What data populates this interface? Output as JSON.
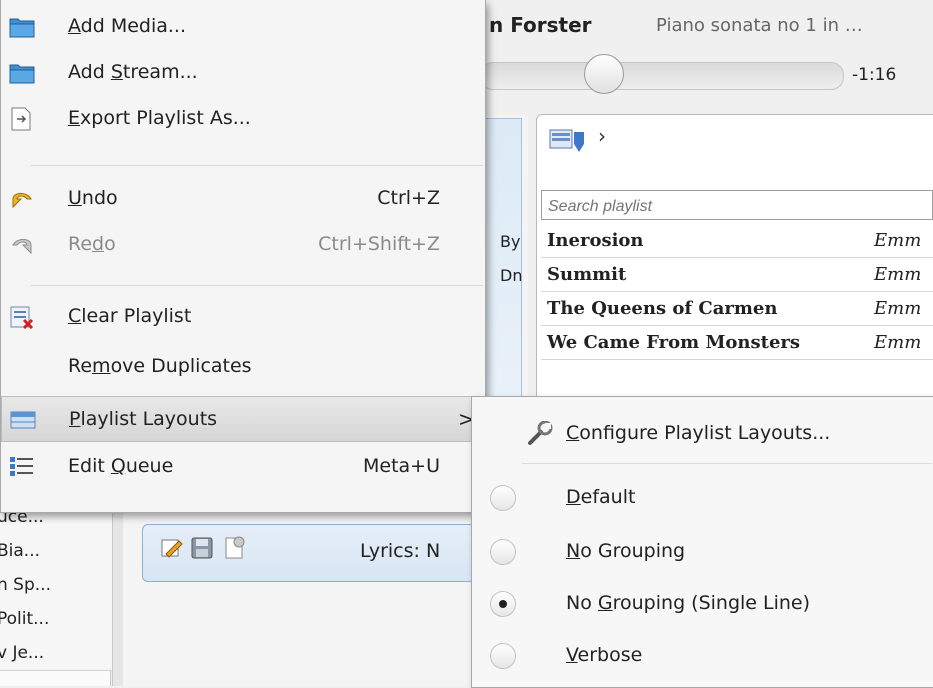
{
  "now_playing": {
    "artist": "n Forster",
    "track": "Piano sonata no 1 in …",
    "time_remaining": "-1:16"
  },
  "left_list": [
    "uce...",
    "Bia...",
    "n Sp...",
    "Polit...",
    "v Je..."
  ],
  "middle_fragments": [
    "By",
    "Dn"
  ],
  "playlist": {
    "search_placeholder": "Search playlist",
    "rows": [
      {
        "title": "Inerosion",
        "artist": "Emm"
      },
      {
        "title": "Summit",
        "artist": "Emm"
      },
      {
        "title": "The Queens of Carmen",
        "artist": "Emm"
      },
      {
        "title": "We Came From Monsters",
        "artist": "Emm"
      }
    ]
  },
  "lyrics": {
    "label": "Lyrics: N"
  },
  "menu": {
    "add_media": {
      "pre": "",
      "u": "A",
      "post": "dd Media..."
    },
    "add_stream": {
      "pre": "Add ",
      "u": "S",
      "post": "tream..."
    },
    "export_playlist": {
      "pre": "",
      "u": "E",
      "post": "xport Playlist As..."
    },
    "undo": {
      "pre": "",
      "u": "U",
      "post": "ndo",
      "shortcut": "Ctrl+Z"
    },
    "redo": {
      "pre": "Re",
      "u": "d",
      "post": "o",
      "shortcut": "Ctrl+Shift+Z"
    },
    "clear_playlist": {
      "pre": "",
      "u": "C",
      "post": "lear Playlist"
    },
    "remove_duplicates": {
      "pre": "Re",
      "u": "m",
      "post": "ove Duplicates"
    },
    "playlist_layouts": {
      "pre": "",
      "u": "P",
      "post": "laylist Layouts",
      "arrow": ">"
    },
    "edit_queue": {
      "pre": "Edit ",
      "u": "Q",
      "post": "ueue",
      "shortcut": "Meta+U"
    }
  },
  "submenu": {
    "configure": {
      "pre": "",
      "u": "C",
      "post": "onfigure Playlist Layouts..."
    },
    "layouts": [
      {
        "pre": "",
        "u": "D",
        "post": "efault",
        "selected": false
      },
      {
        "pre": "",
        "u": "N",
        "post": "o Grouping",
        "selected": false
      },
      {
        "pre": "No ",
        "u": "G",
        "post": "rouping (Single Line)",
        "selected": true
      },
      {
        "pre": "",
        "u": "V",
        "post": "erbose",
        "selected": false
      }
    ]
  }
}
